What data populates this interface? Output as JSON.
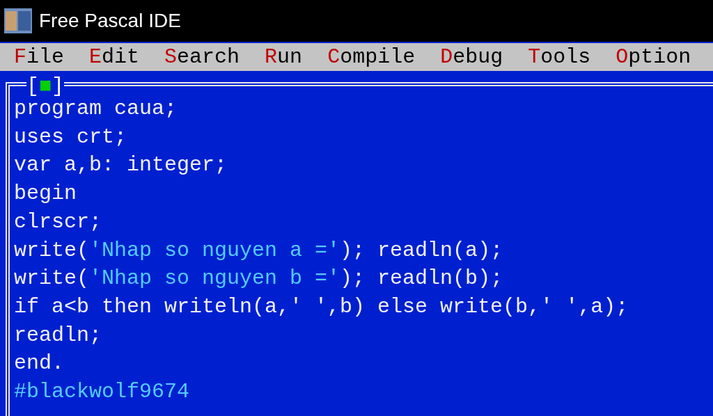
{
  "window": {
    "title": "Free Pascal IDE"
  },
  "menu": [
    {
      "hotkey": "F",
      "rest": "ile"
    },
    {
      "hotkey": "E",
      "rest": "dit"
    },
    {
      "hotkey": "S",
      "rest": "earch"
    },
    {
      "hotkey": "R",
      "rest": "un"
    },
    {
      "hotkey": "C",
      "rest": "ompile"
    },
    {
      "hotkey": "D",
      "rest": "ebug"
    },
    {
      "hotkey": "T",
      "rest": "ools"
    },
    {
      "hotkey": "O",
      "rest": "ption"
    }
  ],
  "editor": {
    "close_box": {
      "open": "[",
      "mark": "■",
      "close": "]"
    },
    "lines": [
      [
        {
          "kind": "plain",
          "text": "program caua;"
        }
      ],
      [
        {
          "kind": "plain",
          "text": "uses crt;"
        }
      ],
      [
        {
          "kind": "plain",
          "text": "var a,b: integer;"
        }
      ],
      [
        {
          "kind": "plain",
          "text": "begin"
        }
      ],
      [
        {
          "kind": "plain",
          "text": "clrscr;"
        }
      ],
      [
        {
          "kind": "plain",
          "text": "write("
        },
        {
          "kind": "string",
          "text": "'Nhap so nguyen a ='"
        },
        {
          "kind": "plain",
          "text": "); readln(a);"
        }
      ],
      [
        {
          "kind": "plain",
          "text": "write("
        },
        {
          "kind": "string",
          "text": "'Nhap so nguyen b ='"
        },
        {
          "kind": "plain",
          "text": "); readln(b);"
        }
      ],
      [
        {
          "kind": "plain",
          "text": "if a<b then writeln(a,' ',b) else write(b,' ',a);"
        }
      ],
      [
        {
          "kind": "plain",
          "text": "readln;"
        }
      ],
      [
        {
          "kind": "plain",
          "text": "end."
        }
      ],
      [
        {
          "kind": "string",
          "text": "#blackwolf9674"
        }
      ]
    ]
  }
}
